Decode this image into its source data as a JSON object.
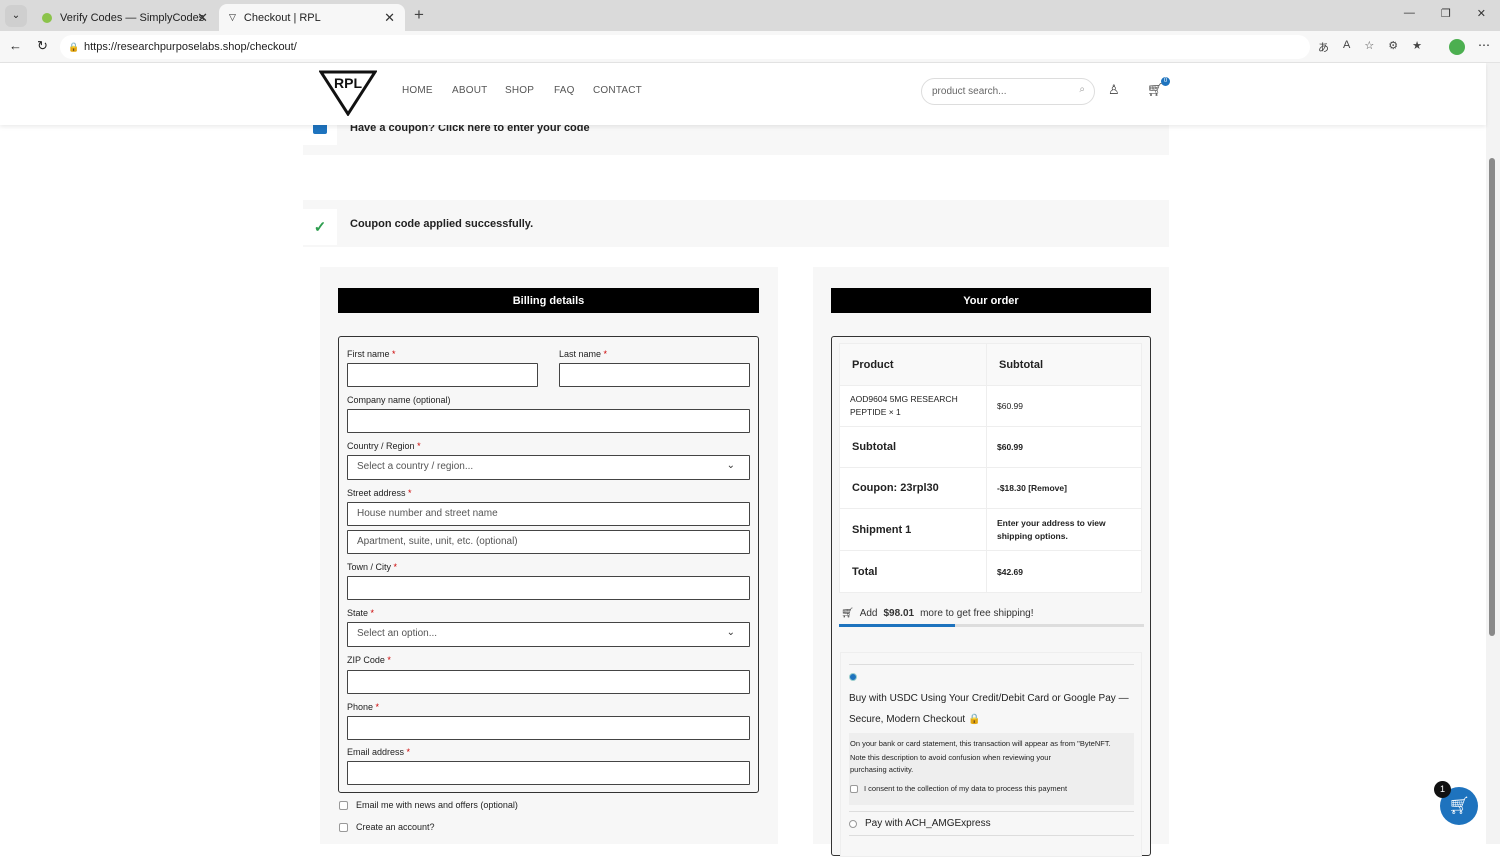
{
  "browser": {
    "tabs": [
      {
        "label": "Verify Codes — SimplyCodes"
      },
      {
        "label": "Checkout | RPL"
      }
    ],
    "url": "https://researchpurposelabs.shop/checkout/"
  },
  "header": {
    "logo": "RPL",
    "nav": [
      "HOME",
      "ABOUT",
      "SHOP",
      "FAQ",
      "CONTACT"
    ],
    "search_placeholder": "product search...",
    "cart_badge": "0"
  },
  "notices": {
    "coupon_prompt": "Have a coupon? Click here to enter your code",
    "coupon_success": "Coupon code applied successfully."
  },
  "billing": {
    "title": "Billing details",
    "fields": {
      "first_name": "First name",
      "last_name": "Last name",
      "company": "Company name (optional)",
      "country": "Country / Region",
      "country_placeholder": "Select a country / region...",
      "street": "Street address",
      "street_placeholder": "House number and street name",
      "street2_placeholder": "Apartment, suite, unit, etc. (optional)",
      "town": "Town / City",
      "state": "State",
      "state_placeholder": "Select an option...",
      "zip": "ZIP Code",
      "phone": "Phone",
      "email": "Email address"
    },
    "required_mark": "*",
    "email_opt_in": "Email me with news and offers (optional)",
    "create_account": "Create an account?"
  },
  "order": {
    "title": "Your order",
    "headers": [
      "Product",
      "Subtotal"
    ],
    "rows": [
      {
        "label": "AOD9604 5MG RESEARCH PEPTIDE × 1",
        "value": "$60.99"
      },
      {
        "label": "Subtotal",
        "value": "$60.99"
      },
      {
        "label": "Coupon: 23rpl30",
        "value": "-$18.30 [Remove]"
      },
      {
        "label": "Shipment 1",
        "value": "Enter your address to view shipping options."
      },
      {
        "label": "Total",
        "value": "$42.69"
      }
    ],
    "free_shipping": {
      "prefix": "Add",
      "amount": "$98.01",
      "suffix": "more to get free shipping!",
      "progress": 0.38
    },
    "payment": {
      "usdc_label": "Buy with USDC Using Your Credit/Debit Card or Google Pay — Secure, Modern Checkout 🔒",
      "statement_note": "On your bank or card statement, this transaction will appear as from \"ByteNFT.",
      "note2": "Note this description to avoid confusion when reviewing your purchasing activity.",
      "consent": "I consent to the collection of my data to process this payment",
      "ach_label": "Pay with ACH_AMGExpress"
    }
  },
  "floating_cart": {
    "badge": "1"
  },
  "colors": {
    "accent": "#1e73be",
    "black": "#000000"
  }
}
